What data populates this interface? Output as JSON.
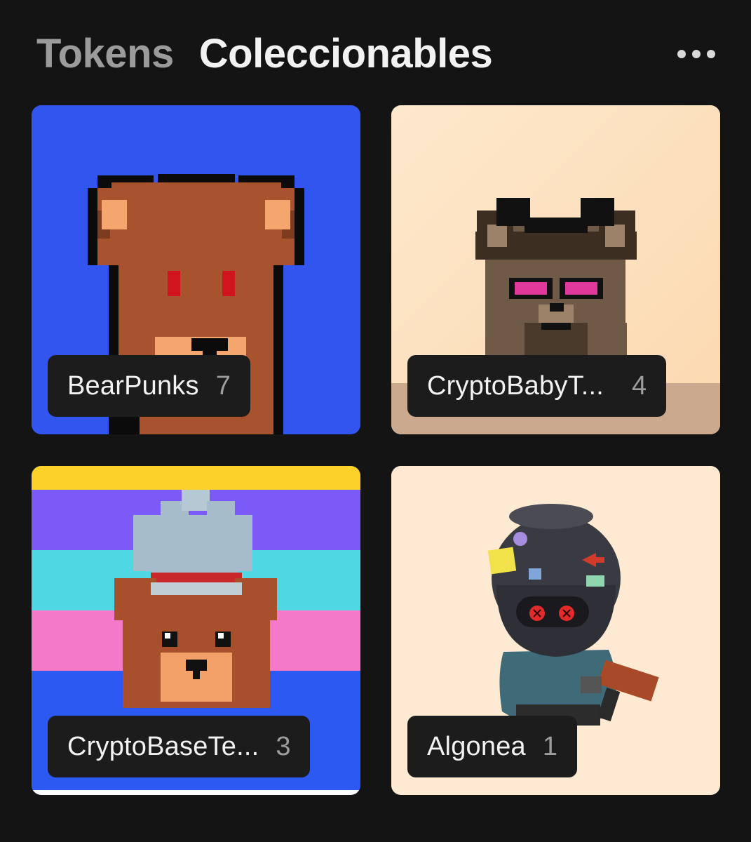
{
  "header": {
    "tabs": [
      {
        "label": "Tokens",
        "active": false
      },
      {
        "label": "Coleccionables",
        "active": true
      }
    ],
    "more_icon": "more-horizontal-icon"
  },
  "collections": [
    {
      "name": "BearPunks",
      "count": "7",
      "background": "#3355ef"
    },
    {
      "name": "CryptoBabyT...",
      "count": "4",
      "background": "#fde4c3"
    },
    {
      "name": "CryptoBaseTe...",
      "count": "3",
      "background": "#2b59f2"
    },
    {
      "name": "Algonea",
      "count": "1",
      "background": "#fee9d2"
    }
  ]
}
